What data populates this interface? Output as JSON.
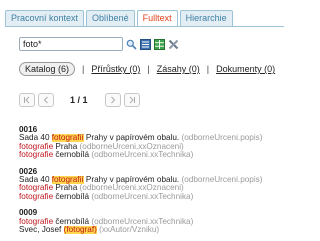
{
  "tabs": [
    {
      "label": "Pracovní kontext",
      "active": false
    },
    {
      "label": "Oblíbené",
      "active": false
    },
    {
      "label": "Fulltext",
      "active": true
    },
    {
      "label": "Hierarchie",
      "active": false
    }
  ],
  "search": {
    "value": "foto*"
  },
  "toolbar_icons": [
    "search-icon",
    "list-icon",
    "grid-icon",
    "clear-icon"
  ],
  "filters": {
    "katalog": "Katalog (6)",
    "prirustky": "Přírůstky (0)",
    "zasahy": "Zásahy (0)",
    "dokumenty": "Dokumenty (0)",
    "separator": "|"
  },
  "pager": {
    "info": "1 / 1"
  },
  "results": [
    {
      "id": "0016",
      "lines": [
        [
          {
            "t": "Sada 40 ",
            "c": ""
          },
          {
            "t": "fotografií",
            "c": "hl"
          },
          {
            "t": " Prahy v papírovém obalu.",
            "c": ""
          },
          {
            "t": " (odborneUrceni.popis)",
            "c": "gray"
          }
        ],
        [
          {
            "t": "fotografie",
            "c": "red"
          },
          {
            "t": " Praha",
            "c": ""
          },
          {
            "t": " (odborneUrceni.xxOznaceni)",
            "c": "gray"
          }
        ],
        [
          {
            "t": "fotografie",
            "c": "red"
          },
          {
            "t": " černobílá",
            "c": ""
          },
          {
            "t": " (odborneUrceni.xxTechnika)",
            "c": "gray"
          }
        ]
      ]
    },
    {
      "id": "0026",
      "lines": [
        [
          {
            "t": "Sada 40 ",
            "c": ""
          },
          {
            "t": "fotografií",
            "c": "hl"
          },
          {
            "t": " Prahy v papírovém obalu.",
            "c": ""
          },
          {
            "t": " (odborneUrceni.popis)",
            "c": "gray"
          }
        ],
        [
          {
            "t": "fotografie",
            "c": "red"
          },
          {
            "t": " Praha",
            "c": ""
          },
          {
            "t": " (odborneUrceni.xxOznaceni)",
            "c": "gray"
          }
        ],
        [
          {
            "t": "fotografie",
            "c": "red"
          },
          {
            "t": " černobílá",
            "c": ""
          },
          {
            "t": " (odborneUrceni.xxTechnika)",
            "c": "gray"
          }
        ]
      ]
    },
    {
      "id": "0009",
      "lines": [
        [
          {
            "t": "fotografie",
            "c": "red"
          },
          {
            "t": " černobílá",
            "c": ""
          },
          {
            "t": " (odborneUrceni.xxTechnika)",
            "c": "gray"
          }
        ],
        [
          {
            "t": "Švec, Josef ",
            "c": ""
          },
          {
            "t": "(fotograf)",
            "c": "hl"
          },
          {
            "t": " (xxAutor/Vzniku)",
            "c": "gray"
          }
        ]
      ]
    }
  ]
}
